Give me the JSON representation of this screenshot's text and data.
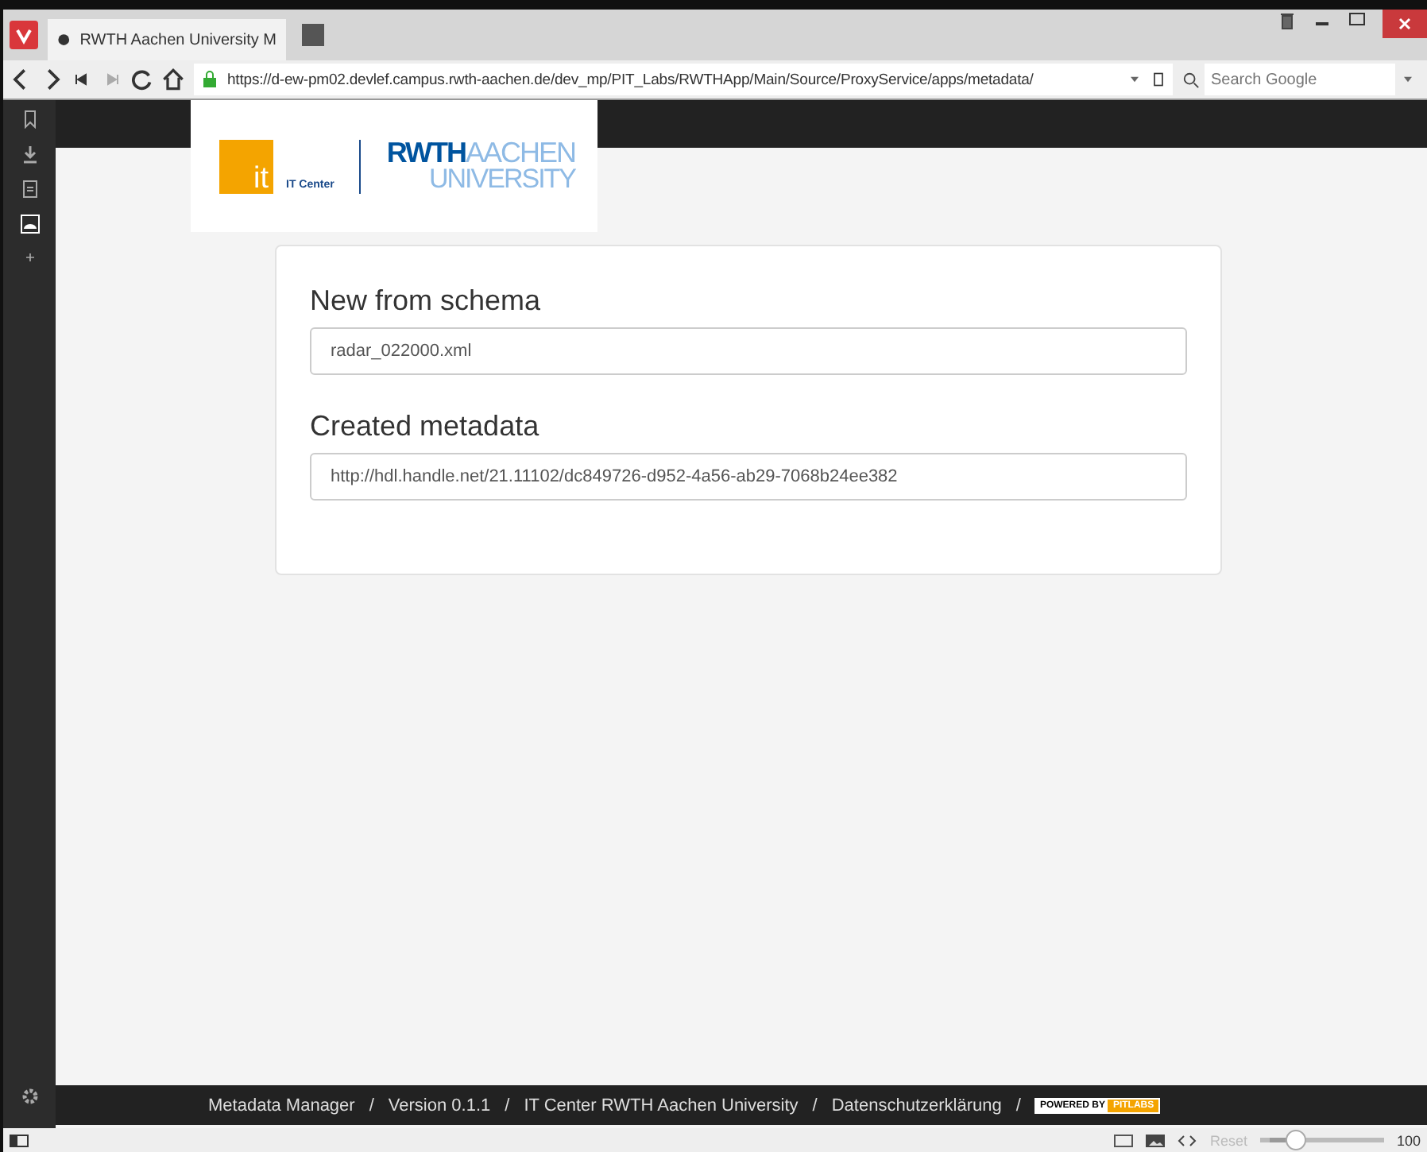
{
  "browser": {
    "tab": {
      "title": "RWTH Aachen University M",
      "selected": true
    },
    "address": "https://d-ew-pm02.devlef.campus.rwth-aachen.de/dev_mp/PIT_Labs/RWTHApp/Main/Source/ProxyService/apps/metadata/",
    "search": {
      "placeholder": "Search Google"
    },
    "status_bar": {
      "reset": "Reset",
      "zoom": "100",
      "level": 0.25
    }
  },
  "logo": {
    "it": "it",
    "it_center": "IT Center",
    "rwth": "RWTH",
    "aachen": "AACHEN",
    "university": "UNIVERSITY"
  },
  "sections": [
    {
      "heading": "New from schema",
      "value": "radar_022000.xml"
    },
    {
      "heading": "Created metadata",
      "value": "http://hdl.handle.net/21.11102/dc849726-d952-4a56-ab29-7068b24ee382"
    }
  ],
  "footer": {
    "items": [
      "Metadata Manager",
      "Version 0.1.1",
      "IT Center RWTH Aachen University",
      "Datenschutzerklärung"
    ],
    "separator": "/",
    "badge": {
      "prefix": "POWERED BY",
      "brand": "PITLABS"
    }
  }
}
